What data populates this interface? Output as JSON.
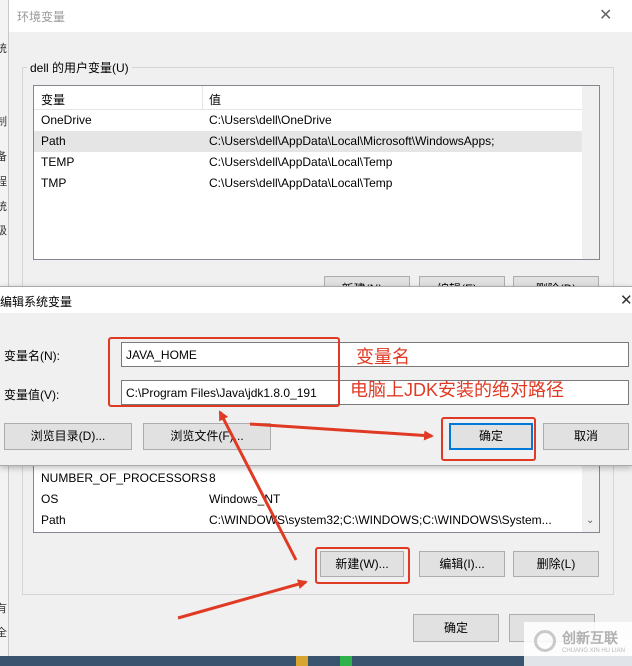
{
  "env_dialog": {
    "title": "环境变量",
    "close_glyph": "✕",
    "user_group_label": "dell 的用户变量(U)",
    "columns": [
      "变量",
      "值"
    ],
    "user_rows": [
      {
        "name": "OneDrive",
        "value": "C:\\Users\\dell\\OneDrive"
      },
      {
        "name": "Path",
        "value": "C:\\Users\\dell\\AppData\\Local\\Microsoft\\WindowsApps;"
      },
      {
        "name": "TEMP",
        "value": "C:\\Users\\dell\\AppData\\Local\\Temp"
      },
      {
        "name": "TMP",
        "value": "C:\\Users\\dell\\AppData\\Local\\Temp"
      }
    ],
    "hidden_user_buttons": [
      "新建(N)...",
      "编辑(E)...",
      "删除(D)"
    ],
    "system_rows": [
      {
        "name": "NUMBER_OF_PROCESSORS",
        "value": "8"
      },
      {
        "name": "OS",
        "value": "Windows_NT"
      },
      {
        "name": "Path",
        "value": "C:\\WINDOWS\\system32;C:\\WINDOWS;C:\\WINDOWS\\System..."
      }
    ],
    "system_buttons": {
      "new": "新建(W)...",
      "edit": "编辑(I)...",
      "delete": "删除(L)"
    },
    "ok_label": "确定",
    "left_edge_chars": [
      "统",
      "制",
      "备",
      "程",
      "统",
      "级",
      "有",
      "全"
    ]
  },
  "edit_dialog": {
    "title": "编辑系统变量",
    "close_glyph": "✕",
    "name_label": "变量名(N):",
    "name_value": "JAVA_HOME",
    "value_label": "变量值(V):",
    "value_value": "C:\\Program Files\\Java\\jdk1.8.0_191",
    "browse_dir_label": "浏览目录(D)...",
    "browse_file_label": "浏览文件(F)...",
    "ok_label": "确定",
    "cancel_label": "取消"
  },
  "annotations": {
    "name_note": "变量名",
    "value_note": "电脑上JDK安装的绝对路径",
    "accent_color": "#e03a24"
  },
  "watermark": {
    "brand": "创新互联",
    "sub": "CHUANG XIN HU LIAN"
  }
}
